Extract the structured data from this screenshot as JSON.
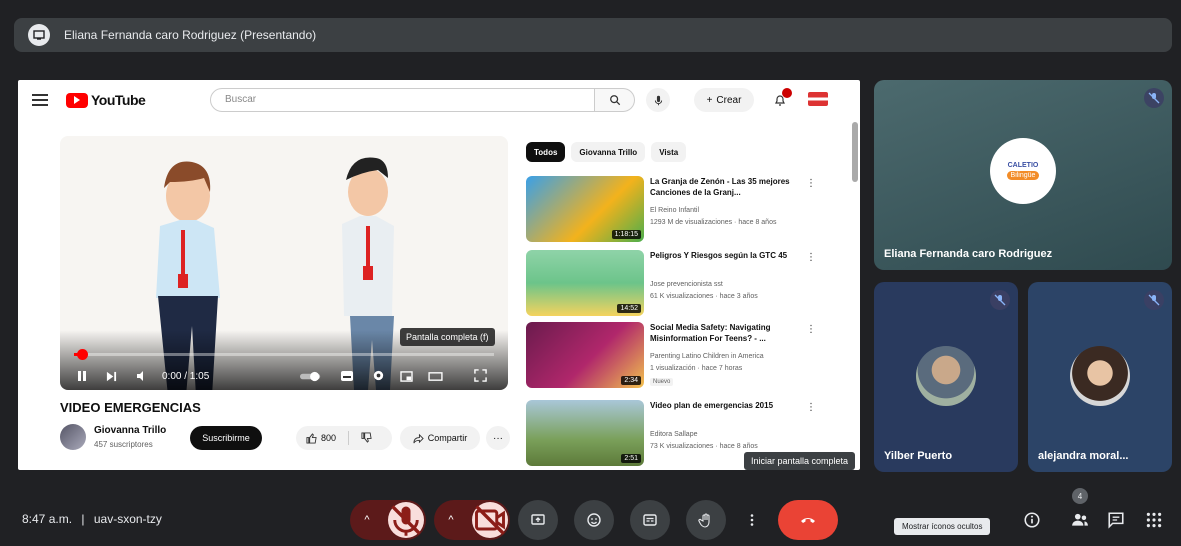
{
  "presenter_bar": {
    "text": "Eliana Fernanda caro Rodriguez (Presentando)"
  },
  "youtube": {
    "logo_text": "YouTube",
    "search_placeholder": "Buscar",
    "create_label": "Crear",
    "chips": [
      "Todos",
      "Giovanna Trillo",
      "Vista"
    ],
    "video": {
      "time": "0:00 / 1:05",
      "progress": 0.02,
      "fullscreen_tooltip": "Pantalla completa (f)",
      "title": "VIDEO EMERGENCIAS",
      "channel": "Giovanna Trillo",
      "subscribers": "457 suscriptores",
      "subscribe_label": "Suscribirme",
      "likes": "800",
      "share_label": "Compartir"
    },
    "recommendations": [
      {
        "title": "La Granja de Zenón - Las 35 mejores Canciones de la Granj...",
        "channel": "El Reino Infantil",
        "meta": "1293 M de visualizaciones · hace 8 años",
        "duration": "1:18:15",
        "badge": ""
      },
      {
        "title": "Peligros Y Riesgos según la GTC 45",
        "channel": "Jose prevencionista sst",
        "meta": "61 K visualizaciones · hace 3 años",
        "duration": "14:52",
        "badge": ""
      },
      {
        "title": "Social Media Safety: Navigating Misinformation For Teens? - ...",
        "channel": "Parenting Latino Children in America",
        "meta": "1 visualización · hace 7 horas",
        "duration": "2:34",
        "badge": "Nuevo"
      },
      {
        "title": "Video plan de emergencias 2015",
        "channel": "Editora Sallape",
        "meta": "73 K visualizaciones · hace 8 años",
        "duration": "2:51",
        "badge": ""
      }
    ]
  },
  "fullscreen_tooltip": "Iniciar pantalla completa",
  "participants": {
    "main": {
      "name": "Eliana Fernanda caro Rodriguez",
      "logo_top": "CALETIO",
      "logo_bottom": "Bilingüe"
    },
    "small": [
      {
        "name": "Yilber Puerto"
      },
      {
        "name": "alejandra moral..."
      }
    ]
  },
  "bottom_bar": {
    "time": "8:47 a.m.",
    "meeting_code": "uav-sxon-tzy",
    "people_count": "4",
    "hidden_icons_tooltip": "Mostrar íconos ocultos"
  },
  "colors": {
    "meet_bg": "#202124",
    "hangup": "#ea4335",
    "muted_bg": "#f9dedc",
    "youtube_red": "#ff0000"
  }
}
